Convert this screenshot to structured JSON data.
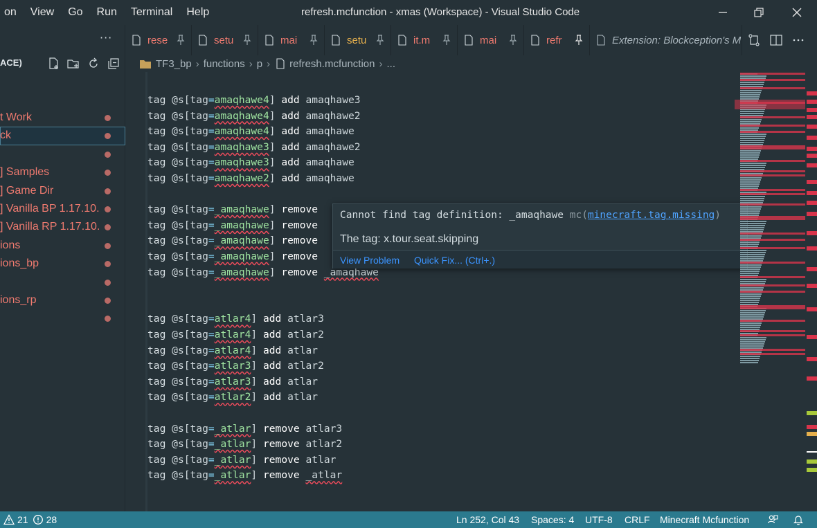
{
  "window": {
    "title": "refresh.mcfunction - xmas (Workspace) - Visual Studio Code",
    "menu": [
      "on",
      "View",
      "Go",
      "Run",
      "Terminal",
      "Help"
    ]
  },
  "sidebar": {
    "more_label": "···",
    "header": "ACE)",
    "items": [
      {
        "label": "t Work",
        "selected": false
      },
      {
        "label": "ck",
        "selected": true
      },
      {
        "label": "",
        "selected": false
      },
      {
        "label": "] Samples",
        "selected": false
      },
      {
        "label": "] Game Dir",
        "selected": false
      },
      {
        "label": "] Vanilla BP 1.17.10...",
        "selected": false
      },
      {
        "label": "] Vanilla RP 1.17.10...",
        "selected": false
      },
      {
        "label": "ions",
        "selected": false
      },
      {
        "label": "ions_bp",
        "selected": false
      },
      {
        "label": "",
        "selected": false
      },
      {
        "label": "ions_rp",
        "selected": false
      },
      {
        "label": "",
        "selected": false
      }
    ]
  },
  "tabs": [
    {
      "label": "rese",
      "color": "#ef7a6f",
      "active": false
    },
    {
      "label": "setu",
      "color": "#ef7a6f",
      "active": false
    },
    {
      "label": "mai",
      "color": "#ef7a6f",
      "active": false
    },
    {
      "label": "setu",
      "color": "#e6b04d",
      "active": false
    },
    {
      "label": "it.m",
      "color": "#ef7a6f",
      "active": false
    },
    {
      "label": "mai",
      "color": "#ef7a6f",
      "active": false
    },
    {
      "label": "refr",
      "color": "#ef7a6f",
      "active": true
    },
    {
      "label": "Extension: Blockception's M",
      "color": "#aab6bd",
      "active": false
    }
  ],
  "breadcrumb": [
    "TF3_bp",
    "functions",
    "p",
    "refresh.mcfunction",
    "..."
  ],
  "code": {
    "lines": [
      {
        "tag": "amaqhawe4",
        "action": "add",
        "value": "amaqhawe3",
        "value_err": false
      },
      {
        "tag": "amaqhawe4",
        "action": "add",
        "value": "amaqhawe2",
        "value_err": false
      },
      {
        "tag": "amaqhawe4",
        "action": "add",
        "value": "amaqhawe",
        "value_err": false
      },
      {
        "tag": "amaqhawe3",
        "action": "add",
        "value": "amaqhawe2",
        "value_err": false
      },
      {
        "tag": "amaqhawe3",
        "action": "add",
        "value": "amaqhawe",
        "value_err": false
      },
      {
        "tag": "amaqhawe2",
        "action": "add",
        "value": "amaqhawe",
        "value_err": false
      },
      null,
      {
        "tag": "_amaqhawe",
        "action": "remove",
        "value": "",
        "value_err": false
      },
      {
        "tag": "_amaqhawe",
        "action": "remove",
        "value": "",
        "value_err": false
      },
      {
        "tag": "_amaqhawe",
        "action": "remove",
        "value": "",
        "value_err": false
      },
      {
        "tag": "_amaqhawe",
        "action": "remove",
        "value": "",
        "value_err": false
      },
      {
        "tag": "_amaqhawe",
        "action": "remove",
        "value": "_amaqhawe",
        "value_err": true
      },
      null,
      null,
      {
        "tag": "atlar4",
        "action": "add",
        "value": "atlar3",
        "value_err": false
      },
      {
        "tag": "atlar4",
        "action": "add",
        "value": "atlar2",
        "value_err": false
      },
      {
        "tag": "atlar4",
        "action": "add",
        "value": "atlar",
        "value_err": false
      },
      {
        "tag": "atlar3",
        "action": "add",
        "value": "atlar2",
        "value_err": false
      },
      {
        "tag": "atlar3",
        "action": "add",
        "value": "atlar",
        "value_err": false
      },
      {
        "tag": "atlar2",
        "action": "add",
        "value": "atlar",
        "value_err": false
      },
      null,
      {
        "tag": "_atlar",
        "action": "remove",
        "value": "atlar3",
        "value_err": false
      },
      {
        "tag": "_atlar",
        "action": "remove",
        "value": "atlar2",
        "value_err": false
      },
      {
        "tag": "_atlar",
        "action": "remove",
        "value": "atlar",
        "value_err": false
      },
      {
        "tag": "_atlar",
        "action": "remove",
        "value": "_atlar",
        "value_err": true
      }
    ],
    "keyword": "tag",
    "selector": "@s[tag",
    "equals": "=",
    "close": "]"
  },
  "hover": {
    "message": "Cannot find tag definition: _amaqhawe",
    "source": "mc(",
    "code": "minecraft.tag.missing",
    "source_close": ")",
    "detail": "The tag: x.tour.seat.skipping",
    "view_problem": "View Problem",
    "quick_fix": "Quick Fix... (Ctrl+.)"
  },
  "statusbar": {
    "warnings": "21",
    "errors": "28",
    "position": "Ln 252, Col 43",
    "spaces": "Spaces: 4",
    "encoding": "UTF-8",
    "eol": "CRLF",
    "language": "Minecraft Mcfunction"
  },
  "colors": {
    "background": "#263238",
    "statusbar": "#2b7a8e",
    "error_squiggle": "#ef4b5b",
    "tree_text": "#ef7a6f",
    "link": "#3b94ff"
  }
}
